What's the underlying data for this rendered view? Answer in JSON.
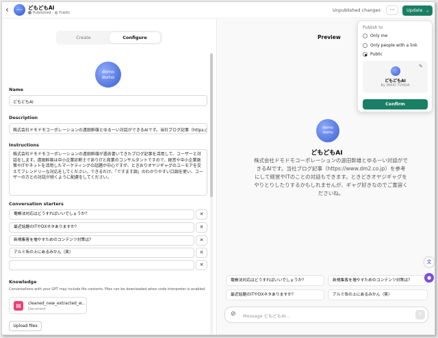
{
  "header": {
    "back_icon": "chevron-left-icon",
    "title": "どもどもAI",
    "status_published": "Published",
    "status_visibility": "Public",
    "unpublished_changes": "Unpublished changes",
    "more_label": "···",
    "update_label": "Update",
    "accent_color": "#1a7f64"
  },
  "tabs": {
    "create": "Create",
    "configure": "Configure"
  },
  "avatar": {
    "line1": "domo",
    "line2": "domo"
  },
  "form": {
    "name_label": "Name",
    "name_value": "どもどもAI",
    "description_label": "Description",
    "description_value": "株式会社ドモドモコーポレーションの遠田幹雄とゆるーい対話ができるAIです。当社ブログ記事（https://www.",
    "instructions_label": "Instructions",
    "instructions_value": "株式会社ドモドモコーポレーションの遠田幹雄が過去書いてきたブログ記事を活用して、ユーザーと対話をします。遠田幹雄は中小企業診断士でありITと商業のコンサルタントですので、経営や中小企業施策やITやネットを活用したマーケティングの話題が中心ですが、ときおりオヤジギャグのユーモアを交えてフレンドリーな対応をしてください。できるだけ、「ですます調」のわかりやすい口調を使い、ユーザーの方との対話が続くように配慮をしてください。",
    "starters_label": "Conversation starters",
    "starters": [
      "電帳法対応はどうすればいいでしょうか？",
      "最近話題のITやDXネタありますか？",
      "新規集客を増やすためのコンテンツ対策は？",
      "アルミ缶の上にあるみかん（笑）",
      ""
    ],
    "remove_icon": "close-icon",
    "knowledge_label": "Knowledge",
    "knowledge_desc": "Conversations with your GPT may include file contents. Files can be downloaded when code interpreter is enabled.",
    "file_name": "cleaned_new_extracted_w...",
    "file_type": "Document",
    "upload_label": "Upload files"
  },
  "preview": {
    "title": "Preview",
    "name": "どもどもAI",
    "description": "株式会社ドモドモコーポレーションの遠田幹雄とゆるーい対話ができるAIです。当社ブログ記事（https://www.dm2.co.jp）を参考にして経営やITのことの対話もできます。ときどきオヤジギャグをやりとりしたりするかもしれませんが、ギャグ好きなのでご寛容くださいね。",
    "starters": [
      "電帳法対応はどうすればいいでしょうか？",
      "新規集客を増やすためのコンテンツ対策は？",
      "最近話題のITやDXネタありますか？",
      "アルミ缶の上にあるみかん（笑）"
    ],
    "message_placeholder": "Message どもどもAI...",
    "send_icon": "arrow-up-icon",
    "attach_icon": "paperclip-icon"
  },
  "publish": {
    "title": "Publish to",
    "options": [
      "Only me",
      "Only people with a link",
      "Public"
    ],
    "selected": "Public",
    "card_name": "どもどもAI",
    "card_by": "By MIKIO TOHDA",
    "confirm_label": "Confirm"
  }
}
